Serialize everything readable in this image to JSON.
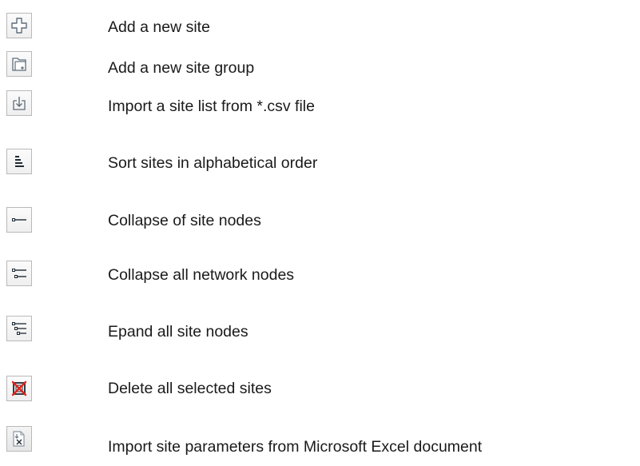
{
  "items": [
    {
      "icon": "add-icon",
      "label": "Add a new site"
    },
    {
      "icon": "folder-add-icon",
      "label": "Add a new site group"
    },
    {
      "icon": "import-csv-icon",
      "label": "Import a site list from *.csv file"
    },
    {
      "icon": "sort-icon",
      "label": "Sort sites in alphabetical order"
    },
    {
      "icon": "collapse-site-nodes-icon",
      "label": "Collapse of site nodes"
    },
    {
      "icon": "collapse-network-nodes-icon",
      "label": "Collapse all network nodes"
    },
    {
      "icon": "expand-nodes-icon",
      "label": "Epand all site nodes"
    },
    {
      "icon": "delete-icon",
      "label": "Delete all selected sites"
    },
    {
      "icon": "import-excel-icon",
      "label": "Import site parameters from Microsoft Excel document"
    }
  ],
  "colors": {
    "icon_stroke": "#5f6d7a",
    "delete_red": "#e0241b",
    "button_border": "#b9b9b9"
  }
}
